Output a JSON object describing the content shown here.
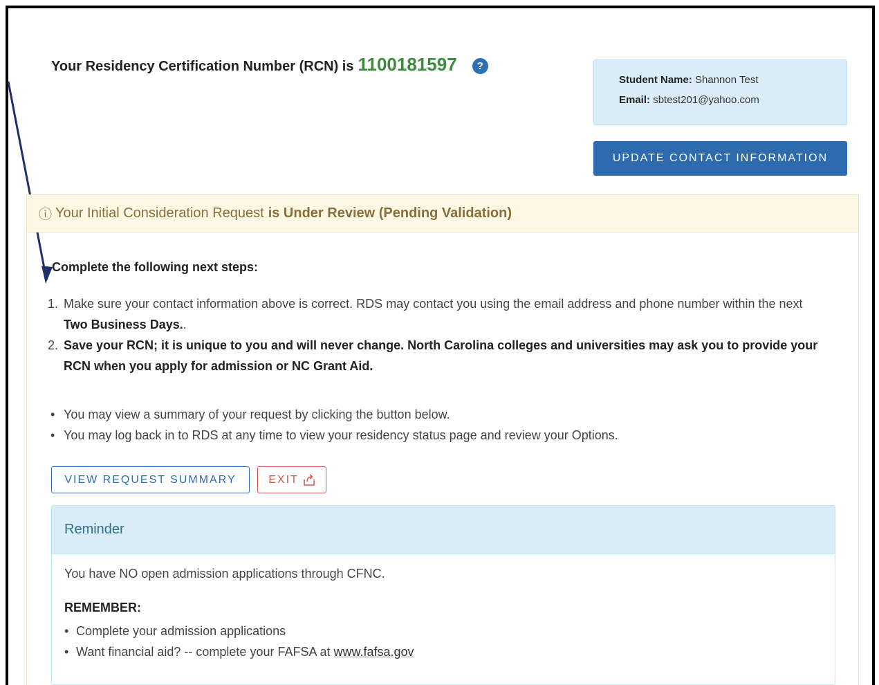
{
  "rcn": {
    "label": "Your Residency Certification Number (RCN) is",
    "number": "1100181597",
    "help_icon": "?"
  },
  "contact": {
    "name_label": "Student Name:",
    "name_value": "Shannon Test",
    "email_label": "Email:",
    "email_value": "sbtest201@yahoo.com",
    "update_button": "UPDATE CONTACT INFORMATION"
  },
  "status": {
    "icon": "ⓘ",
    "text": "Your Initial Consideration Request",
    "strong": "is Under Review (Pending Validation)"
  },
  "next_steps": {
    "title": "Complete the following next steps:",
    "steps": [
      {
        "num": "1.",
        "text": "Make sure your contact information above is correct. RDS may contact you using the email address and phone number within the next",
        "bold": "Two Business Days.",
        "tail": "."
      },
      {
        "num": "2.",
        "bold": "Save your RCN; it is unique to you and will never change. North Carolina colleges and universities may ask you to provide your RCN when you apply for admission or NC Grant Aid."
      }
    ],
    "bullets": [
      "You may view a summary of your request by clicking the button below.",
      "You may log back in to RDS at any time to view your residency status page and review your Options."
    ]
  },
  "actions": {
    "view_summary": "VIEW REQUEST SUMMARY",
    "exit": "EXIT"
  },
  "reminder": {
    "title": "Reminder",
    "message": "You have NO open admission applications through CFNC.",
    "remember_label": "REMEMBER:",
    "items": [
      "Complete your admission applications",
      "Want financial aid? -- complete your FAFSA at"
    ],
    "fafsa_link": "www.fafsa.gov"
  },
  "colors": {
    "rcn_green": "#3c8a3c",
    "primary_blue": "#2d6aae",
    "exit_red": "#d9534f",
    "warning_bg": "#fcf8e3",
    "info_bg": "#d9edf7",
    "arrow": "#1f2f6b"
  }
}
